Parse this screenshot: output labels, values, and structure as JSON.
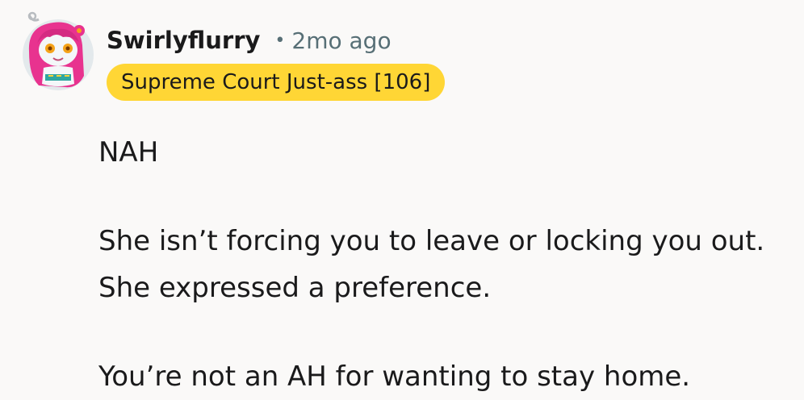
{
  "comment": {
    "author": "Swirlyflurry",
    "separator": "•",
    "timestamp": "2mo ago",
    "flair": "Supreme Court Just-ass [106]",
    "paragraphs": [
      "NAH",
      "She isn’t forcing you to leave or locking you out. She expressed a preference.",
      "You’re not an AH for wanting to stay home."
    ]
  },
  "colors": {
    "background": "#faf9f8",
    "flair_background": "#ffd635",
    "meta_gray": "#576f76",
    "avatar_hair": "#e8338f",
    "avatar_background": "#e8eef0"
  },
  "icons": {
    "avatar": "snoo-avatar-icon"
  }
}
